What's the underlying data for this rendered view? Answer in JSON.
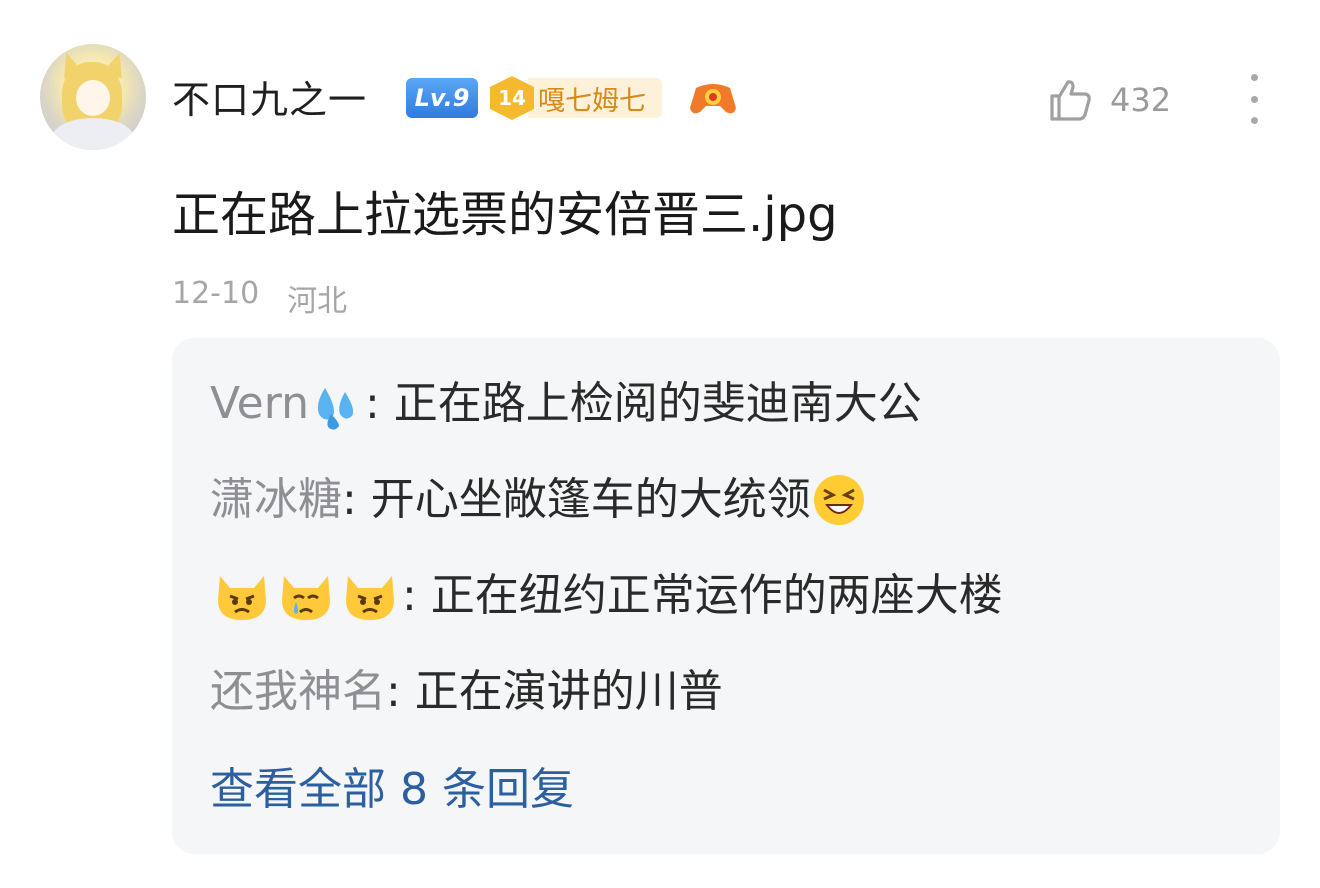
{
  "post": {
    "author": {
      "name": "不口九之一",
      "level_badge": "Lv.9",
      "fan_badge_level": "14",
      "fan_badge_name": "嘎七姆七",
      "avatar_icon": "anime-fox-girl-avatar",
      "extra_badge_icon": "game-controller-icon"
    },
    "likes": "432",
    "content": "正在路上拉选票的安倍晋三.jpg",
    "date": "12-10",
    "location": "河北"
  },
  "replies": [
    {
      "user": "Vern",
      "user_emoji": "sweat-droplets-icon",
      "text": ": 正在路上检阅的斐迪南大公"
    },
    {
      "user": "潇冰糖",
      "text": ": 开心坐敞篷车的大统领",
      "trailing_emoji": "grinning-squinting-face-icon"
    },
    {
      "user_emojis": [
        "pouting-cat-icon",
        "crying-cat-icon",
        "pouting-cat-icon"
      ],
      "text": ": 正在纽约正常运作的两座大楼"
    },
    {
      "user": "还我神名",
      "text": ": 正在演讲的川普"
    }
  ],
  "view_all": "查看全部 8 条回复",
  "colors": {
    "link": "#2b5f9f",
    "muted": "#a6a6a6",
    "reply_bg": "#f5f6f8",
    "level_badge": "#3b8aea",
    "fan_badge": "#f5b92e"
  }
}
